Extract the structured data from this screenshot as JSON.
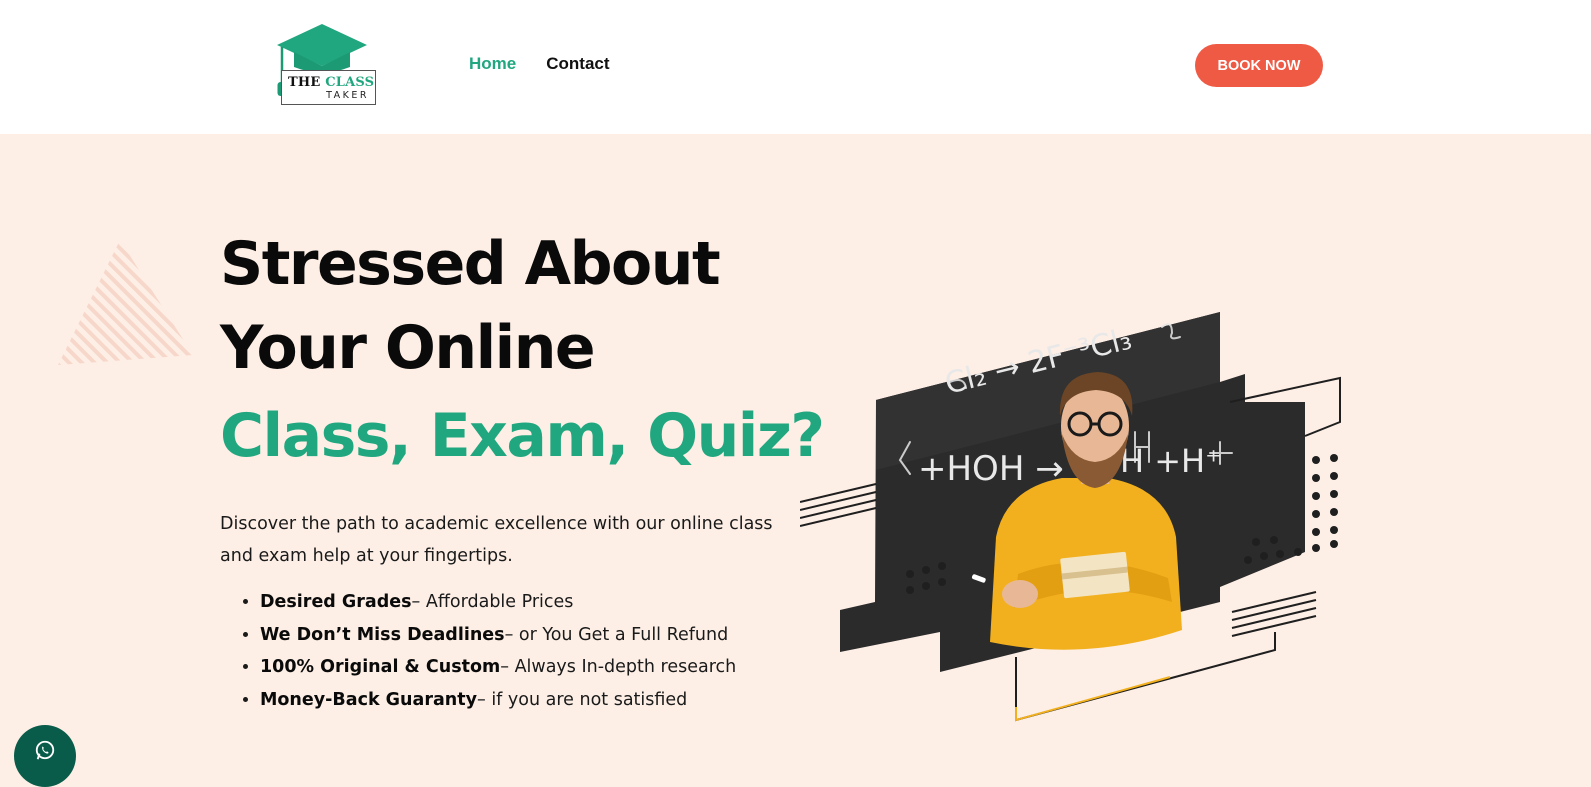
{
  "header": {
    "logo": {
      "line1_word1": "THE",
      "line1_word2": "CLASS",
      "line2": "TAKER"
    },
    "nav": [
      {
        "label": "Home",
        "active": true
      },
      {
        "label": "Contact",
        "active": false
      }
    ],
    "cta_label": "BOOK NOW"
  },
  "hero": {
    "title_line1": "Stressed About",
    "title_line2": "Your Online",
    "title_line3": "Class, Exam, Quiz?",
    "description": "Discover the path to academic excellence with our online class and exam help at your fingertips.",
    "features": [
      {
        "bold": "Desired Grades",
        "text": "– Affordable Prices"
      },
      {
        "bold": "We Don’t Miss Deadlines",
        "text": "– or You Get a Full Refund"
      },
      {
        "bold": "100% Original & Custom",
        "text": "– Always In-depth research"
      },
      {
        "bold": "Money-Back Guaranty",
        "text": "– if you are not satisfied"
      }
    ],
    "chalkboard": {
      "line1": "Cl₂ → 2F⁻³Cl₃",
      "line2": "+HOH →",
      "line3": "H  +H⁺"
    }
  },
  "widgets": {
    "chat_icon": "whatsapp-icon"
  },
  "colors": {
    "accent_green": "#21a77f",
    "cta_red": "#ef5a45",
    "hero_bg": "#fdefe6",
    "whatsapp_bg": "#0a5c4a"
  }
}
